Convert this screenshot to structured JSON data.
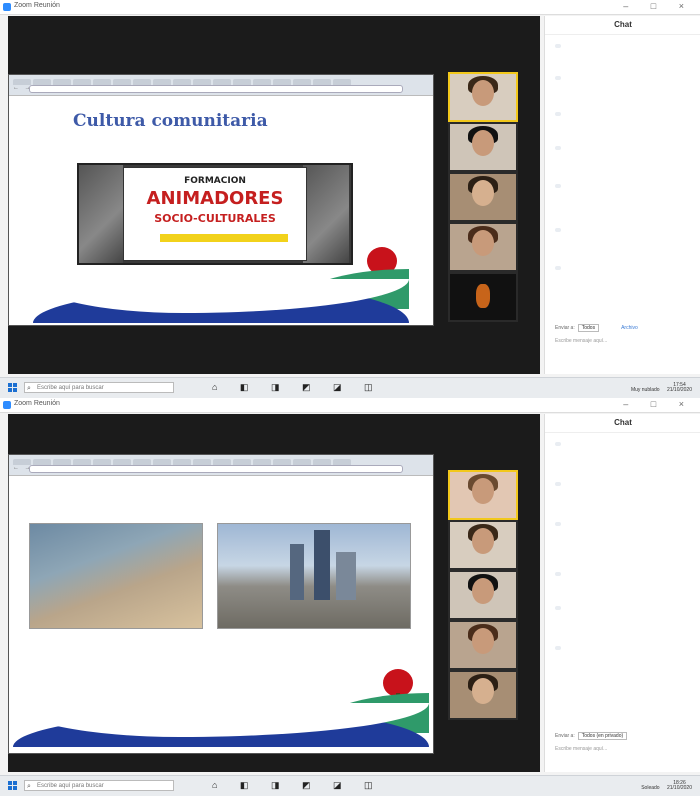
{
  "screens": [
    {
      "window_title": "Zoom Reunión",
      "window_controls": "–  □  ×",
      "slide_title": "Cultura comunitaria",
      "poster": {
        "line1": "FORMACION",
        "line2": "ANIMADORES",
        "line3": "SOCIO-CULTURALES"
      },
      "participants": [
        {
          "name": "",
          "active": true
        },
        {
          "name": "",
          "active": false
        },
        {
          "name": "",
          "active": false
        },
        {
          "name": "",
          "active": false
        },
        {
          "name": "",
          "active": false
        }
      ],
      "chat": {
        "title": "Chat",
        "send_to_label": "Enviar a:",
        "send_to_value": "Todos",
        "file_label": "Archivo",
        "placeholder": "Escribe mensaje aquí...",
        "messages": [
          {
            "sender": "",
            "time": "",
            "text": ""
          },
          {
            "sender": "",
            "time": "",
            "text": ""
          },
          {
            "sender": "",
            "time": "",
            "text": ""
          },
          {
            "sender": "",
            "time": "",
            "text": ""
          },
          {
            "sender": "",
            "time": "",
            "text": ""
          },
          {
            "sender": "",
            "time": "",
            "text": ""
          },
          {
            "sender": "",
            "time": "",
            "text": ""
          }
        ]
      },
      "taskbar": {
        "search_placeholder": "Escribe aquí para buscar",
        "apps": "⌂ ◧ ◨ ◩ ◪ ◫",
        "tray_text": "Muy nublado",
        "clock_time": "17:54",
        "clock_date": "21/10/2020"
      }
    },
    {
      "window_title": "Zoom Reunión",
      "window_controls": "–  □  ×",
      "participants": [
        {
          "name": "",
          "active": true
        },
        {
          "name": "",
          "active": false
        },
        {
          "name": "",
          "active": false
        },
        {
          "name": "",
          "active": false
        },
        {
          "name": "",
          "active": false
        }
      ],
      "chat": {
        "title": "Chat",
        "send_to_label": "Enviar a:",
        "send_to_value": "Todos (en privado)",
        "placeholder": "Escribe mensaje aquí...",
        "messages": [
          {
            "sender": "",
            "time": "",
            "text": ""
          },
          {
            "sender": "",
            "time": "",
            "text": ""
          },
          {
            "sender": "",
            "time": "",
            "text": ""
          },
          {
            "sender": "",
            "time": "",
            "text": ""
          },
          {
            "sender": "",
            "time": "",
            "text": ""
          },
          {
            "sender": "",
            "time": "",
            "text": ""
          }
        ]
      },
      "taskbar": {
        "search_placeholder": "Escribe aquí para buscar",
        "apps": "⌂ ◧ ◨ ◩ ◪ ◫",
        "tray_text": "Soleado",
        "clock_time": "18:26",
        "clock_date": "21/10/2020"
      }
    }
  ]
}
